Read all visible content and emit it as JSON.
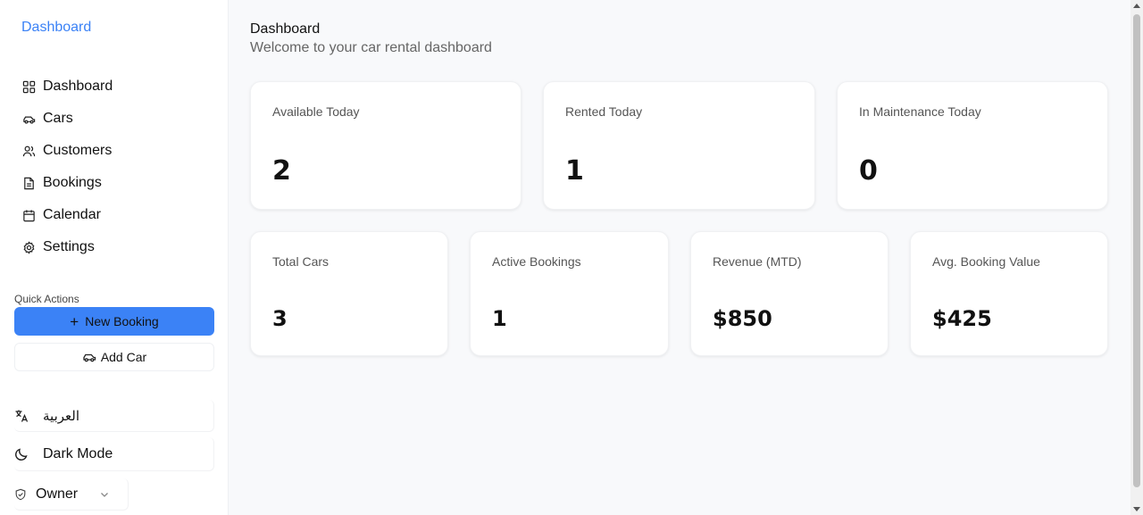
{
  "sidebar": {
    "brand": "Dashboard",
    "nav": [
      {
        "label": "Dashboard",
        "icon": "grid-icon"
      },
      {
        "label": "Cars",
        "icon": "car-icon"
      },
      {
        "label": "Customers",
        "icon": "users-icon"
      },
      {
        "label": "Bookings",
        "icon": "file-icon"
      },
      {
        "label": "Calendar",
        "icon": "calendar-icon"
      },
      {
        "label": "Settings",
        "icon": "gear-icon"
      }
    ],
    "quick_actions_label": "Quick Actions",
    "new_booking_label": "New Booking",
    "add_car_label": "Add Car",
    "language_label": "العربية",
    "dark_mode_label": "Dark Mode",
    "role_label": "Owner"
  },
  "header": {
    "title": "Dashboard",
    "subtitle": "Welcome to your car rental dashboard"
  },
  "stats_row1": [
    {
      "label": "Available Today",
      "value": "2"
    },
    {
      "label": "Rented Today",
      "value": "1"
    },
    {
      "label": "In Maintenance Today",
      "value": "0"
    }
  ],
  "stats_row2": [
    {
      "label": "Total Cars",
      "value": "3"
    },
    {
      "label": "Active Bookings",
      "value": "1"
    },
    {
      "label": "Revenue (MTD)",
      "value": "$850"
    },
    {
      "label": "Avg. Booking Value",
      "value": "$425"
    }
  ],
  "colors": {
    "accent": "#3b82f6",
    "background": "#f8f9fb"
  }
}
